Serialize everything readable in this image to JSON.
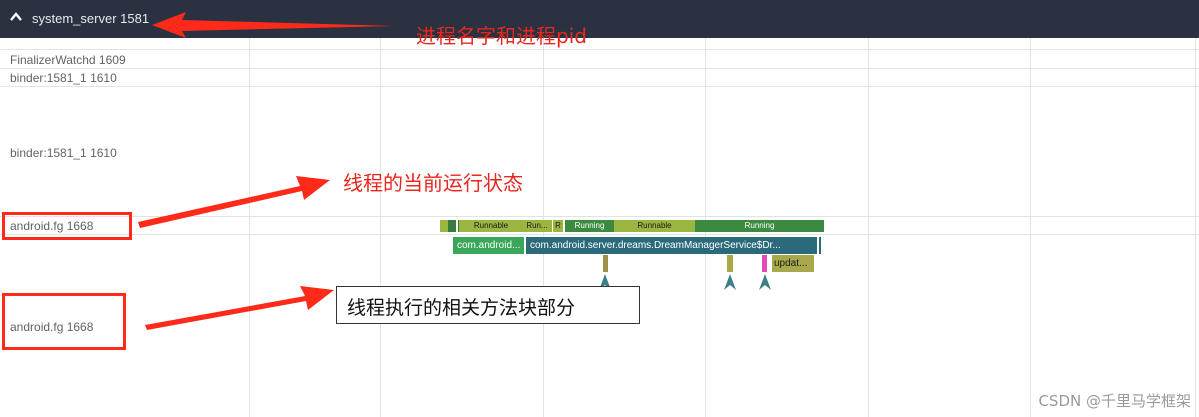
{
  "process": {
    "title": "system_server 1581",
    "icon": "chevron-up-icon"
  },
  "tracks": [
    {
      "label": "FinalizerWatchd 1609"
    },
    {
      "label": "binder:1581_1 1610"
    },
    {
      "label": "binder:1581_1 1610"
    },
    {
      "label": "android.fg 1668"
    },
    {
      "label": "android.fg 1668"
    }
  ],
  "thread_states": [
    {
      "label": "",
      "color": "#9bb640"
    },
    {
      "label": "",
      "color": "#3b7a3f"
    },
    {
      "label": "Runnable",
      "color": "#9bb640"
    },
    {
      "label": "Run...",
      "color": "#9bb640"
    },
    {
      "label": "R",
      "color": "#9bb640"
    },
    {
      "label": "Running",
      "color": "#3b8a3f"
    },
    {
      "label": "Runnable",
      "color": "#9bb640"
    },
    {
      "label": "Running",
      "color": "#3b8a3f"
    }
  ],
  "slices": [
    {
      "label": "com.android...",
      "color": "#3aa65a"
    },
    {
      "label": "com.android.server.dreams.DreamManagerService$Dr...",
      "color": "#2b6a7a"
    },
    {
      "label": "updat...",
      "color": "#a7a94a"
    }
  ],
  "annotations": {
    "process_note": "进程名字和进程pid",
    "state_note": "线程的当前运行状态",
    "method_note": "线程执行的相关方法块部分"
  },
  "watermark": "CSDN @千里马学框架"
}
